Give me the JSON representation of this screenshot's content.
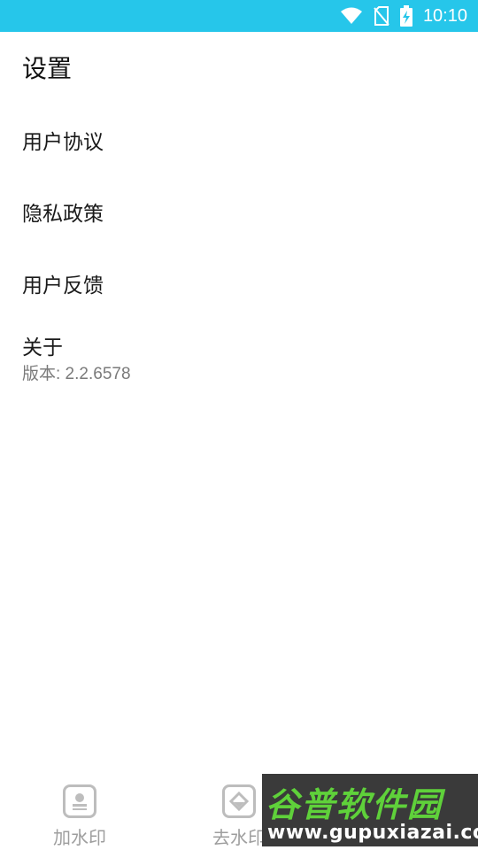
{
  "status_bar": {
    "time": "10:10",
    "icons": [
      "wifi-icon",
      "no-sim-icon",
      "battery-charging-icon"
    ],
    "background_color": "#26c6ea"
  },
  "page": {
    "title": "设置"
  },
  "settings": {
    "items": [
      {
        "label": "用户协议"
      },
      {
        "label": "隐私政策"
      },
      {
        "label": "用户反馈"
      },
      {
        "label": "关于",
        "sub": "版本: 2.2.6578"
      }
    ]
  },
  "bottom_nav": {
    "tabs": [
      {
        "label": "加水印",
        "icon": "stamp-icon"
      },
      {
        "label": "去水印",
        "icon": "eraser-icon"
      }
    ]
  },
  "watermark": {
    "title": "谷普软件园",
    "url": "www.gupuxiazai.com"
  }
}
